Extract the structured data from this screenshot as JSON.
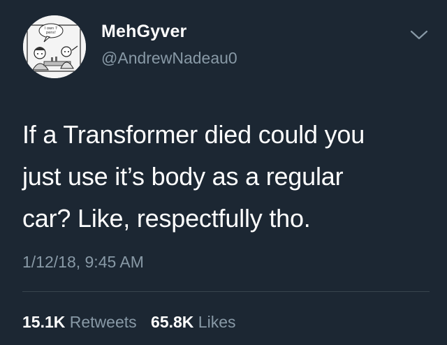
{
  "author": {
    "display_name": "MehGyver",
    "handle": "@AndrewNadeau0",
    "avatar_speech_text": "I own 7 pens!"
  },
  "tweet": {
    "text": "If a Transformer died could you\njust use it’s body as a regular\ncar? Like, respectfully tho.",
    "timestamp": "1/12/18, 9:45 AM"
  },
  "stats": {
    "retweets_count": "15.1K",
    "retweets_label": "Retweets",
    "likes_count": "65.8K",
    "likes_label": "Likes"
  },
  "icons": {
    "menu": "chevron-down-icon"
  },
  "colors": {
    "background": "#1c2733",
    "primary_text": "#ffffff",
    "secondary_text": "#8899a6",
    "divider": "#38444d"
  }
}
